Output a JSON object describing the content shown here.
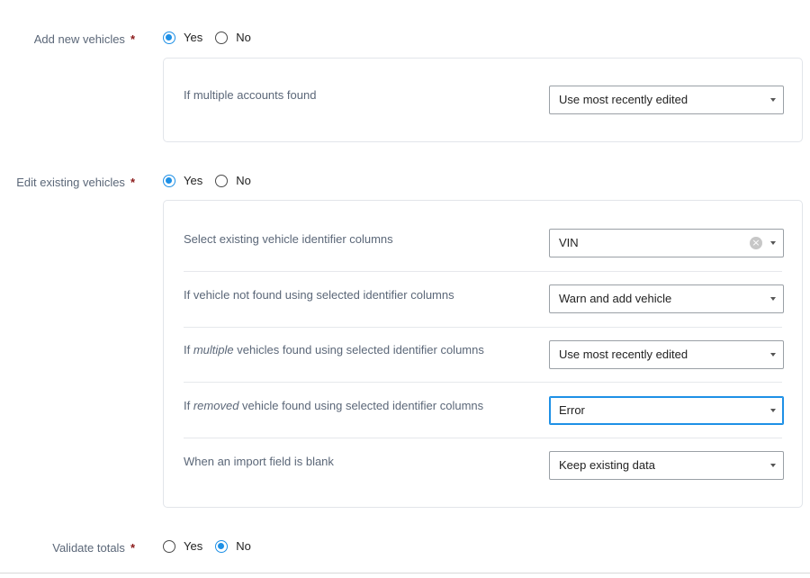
{
  "add_new_vehicles": {
    "label": "Add new vehicles",
    "required": "*",
    "yes": "Yes",
    "no": "No",
    "selected": "Yes",
    "options": [
      {
        "label": "If multiple accounts found",
        "value": "Use most recently edited"
      }
    ]
  },
  "edit_existing_vehicles": {
    "label": "Edit existing vehicles",
    "required": "*",
    "yes": "Yes",
    "no": "No",
    "selected": "Yes",
    "options": [
      {
        "label": "Select existing vehicle identifier columns",
        "value": "VIN",
        "clear_icon": "×"
      },
      {
        "label": "If vehicle not found using selected identifier columns",
        "value": "Warn and add vehicle"
      },
      {
        "label_pre": "If ",
        "label_em": "multiple",
        "label_post": " vehicles found using selected identifier columns",
        "value": "Use most recently edited"
      },
      {
        "label_pre": "If ",
        "label_em": "removed",
        "label_post": " vehicle found using selected identifier columns",
        "value": "Error"
      },
      {
        "label": "When an import field is blank",
        "value": "Keep existing data"
      }
    ]
  },
  "validate_totals": {
    "label": "Validate totals",
    "required": "*",
    "yes": "Yes",
    "no": "No",
    "selected": "No"
  },
  "colors": {
    "accent": "#1e90e6",
    "required": "#8b1a1a",
    "label": "#5b6778"
  },
  "icons": {
    "dropdown": "chevron-down-icon",
    "clear": "clear-icon"
  }
}
